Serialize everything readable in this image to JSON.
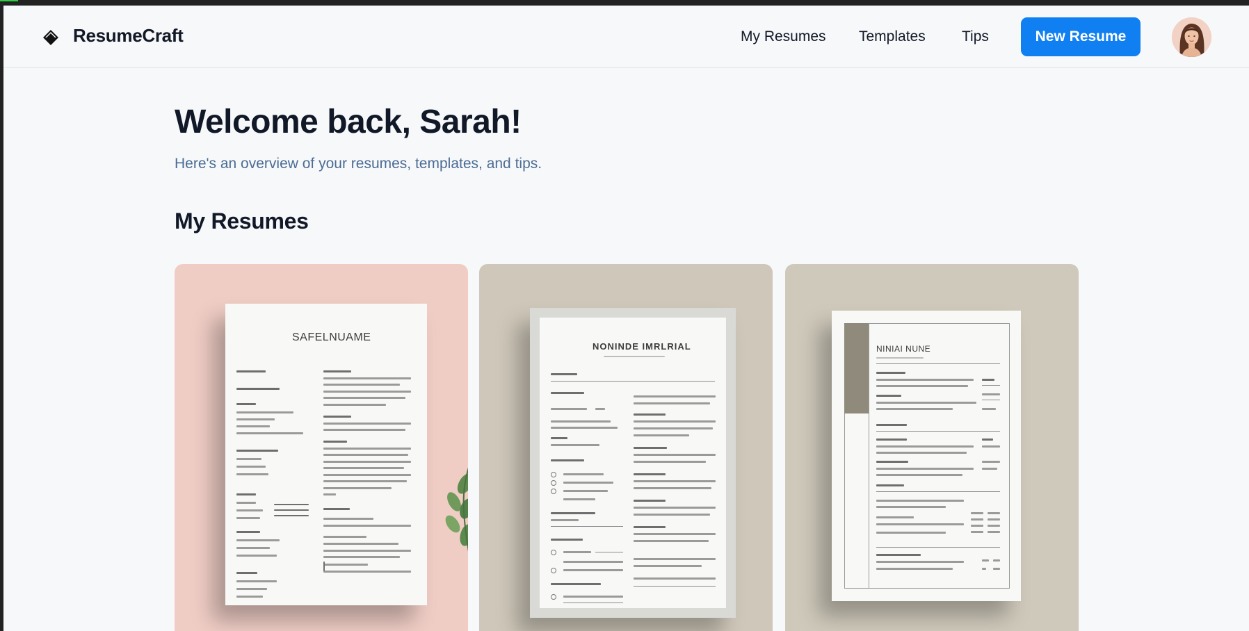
{
  "app": {
    "brand": "ResumeCraft",
    "logo_icon": "diamond-logo-icon"
  },
  "nav": {
    "items": [
      {
        "label": "My Resumes"
      },
      {
        "label": "Templates"
      },
      {
        "label": "Tips"
      }
    ],
    "new_button_label": "New Resume",
    "avatar_icon": "user-avatar"
  },
  "main": {
    "welcome": "Welcome back, Sarah!",
    "subtitle": "Here's an overview of your resumes, templates, and tips.",
    "section_title": "My Resumes"
  },
  "resumes": [
    {
      "thumbnail_title": "SAFELNUAME",
      "background": "#efcdc5"
    },
    {
      "thumbnail_title": "NONINDE IMRLRIAL",
      "background": "#cfc8ba"
    },
    {
      "thumbnail_title": "NINIAI NUNE",
      "background": "#cfc9bb"
    }
  ],
  "colors": {
    "accent": "#0f7ff2",
    "heading": "#111827",
    "subtitle": "#4b6c94",
    "background": "#f7f8fa"
  }
}
